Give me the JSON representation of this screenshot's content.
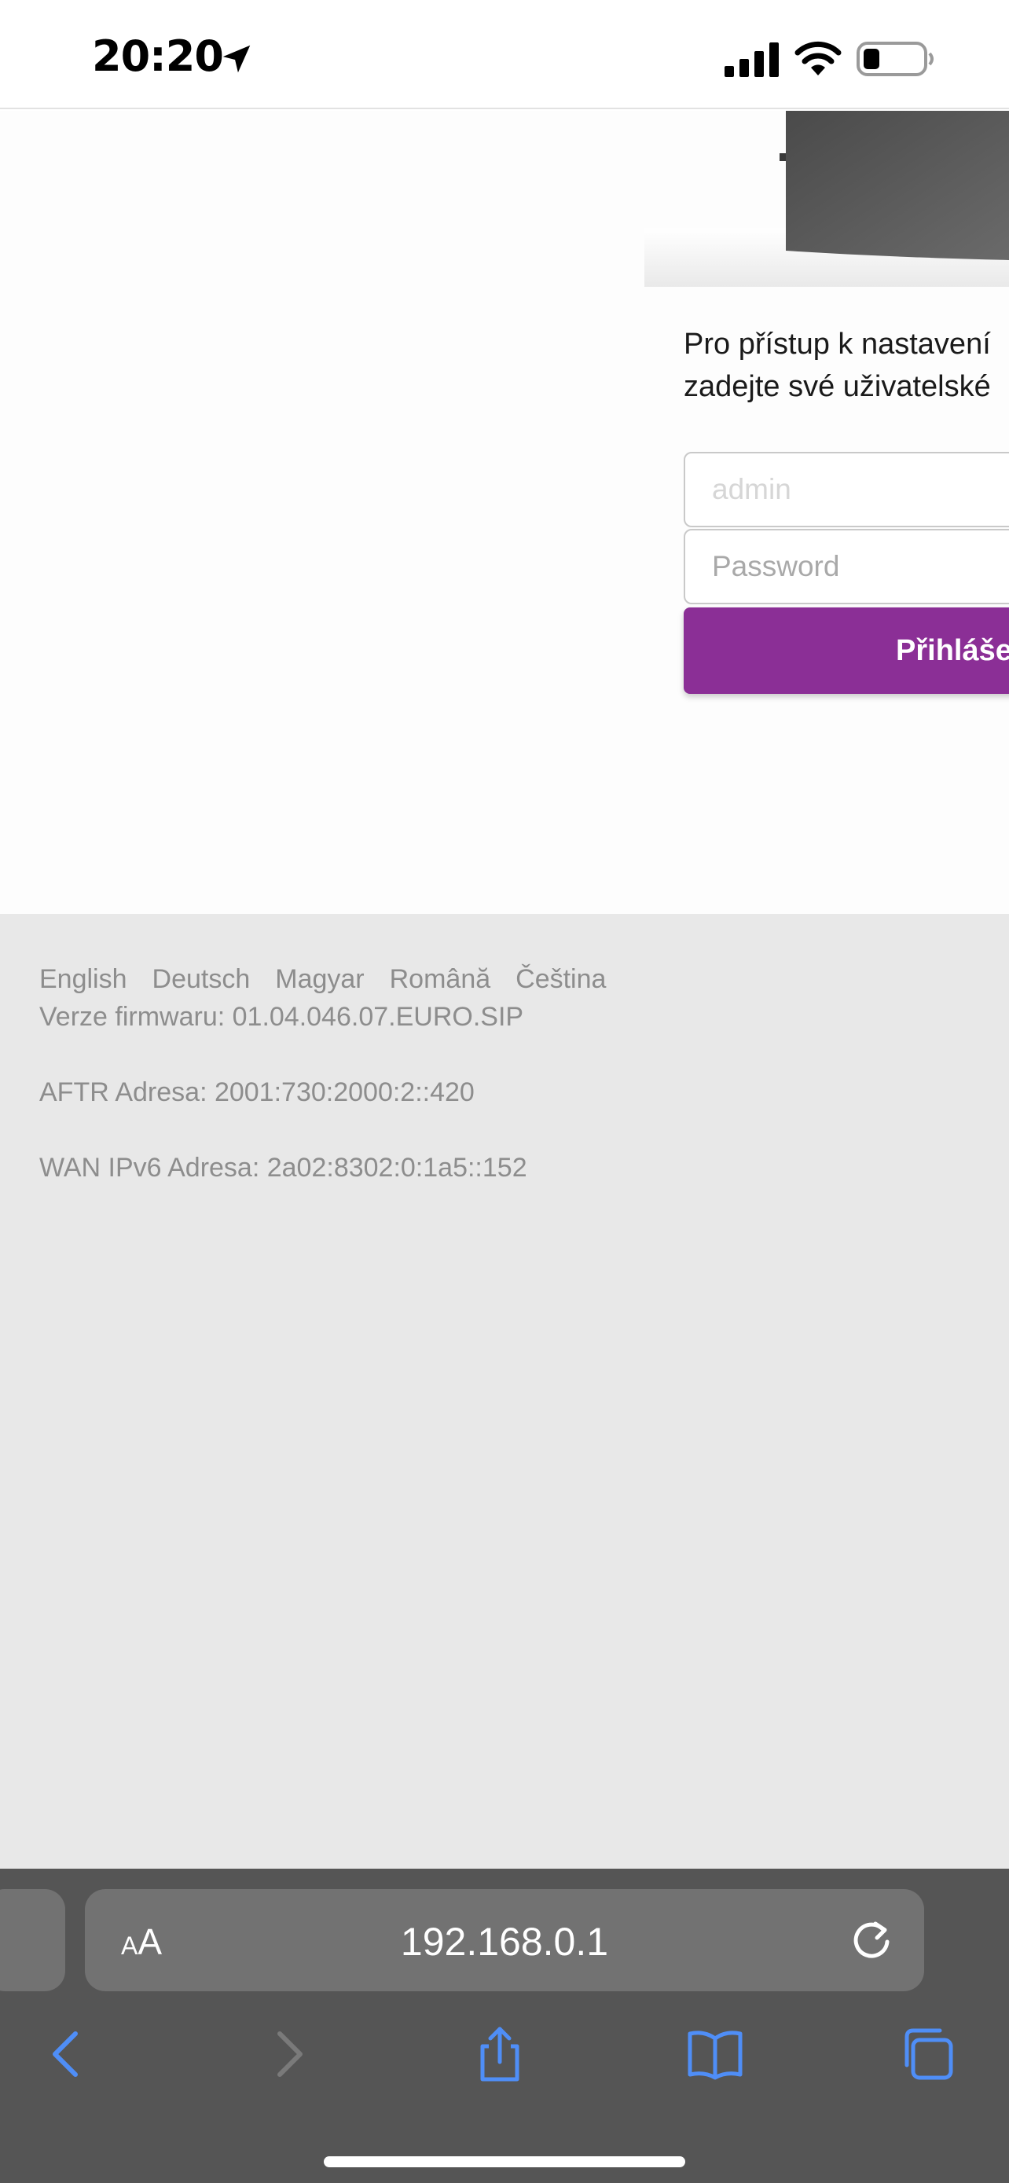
{
  "status_bar": {
    "time": "20:20"
  },
  "login": {
    "intro_line1": "Pro přístup k nastavení",
    "intro_line2": "zadejte své uživatelské",
    "username_placeholder": "admin",
    "password_placeholder": "Password",
    "login_button": "Přihláše"
  },
  "footer": {
    "languages": [
      "English",
      "Deutsch",
      "Magyar",
      "Română",
      "Čeština"
    ],
    "firmware": "Verze firmwaru: 01.04.046.07.EURO.SIP",
    "aftr": "AFTR Adresa: 2001:730:2000:2::420",
    "wan_ipv6": "WAN IPv6 Adresa: 2a02:8302:0:1a5::152"
  },
  "safari": {
    "text_size_small": "A",
    "text_size_big": "A",
    "url": "192.168.0.1"
  },
  "colors": {
    "accent": "#8b2f96",
    "footer_bg": "#e8e8e8",
    "toolbar_bg": "#555555",
    "toolbar_icon": "#4f8ef7"
  }
}
